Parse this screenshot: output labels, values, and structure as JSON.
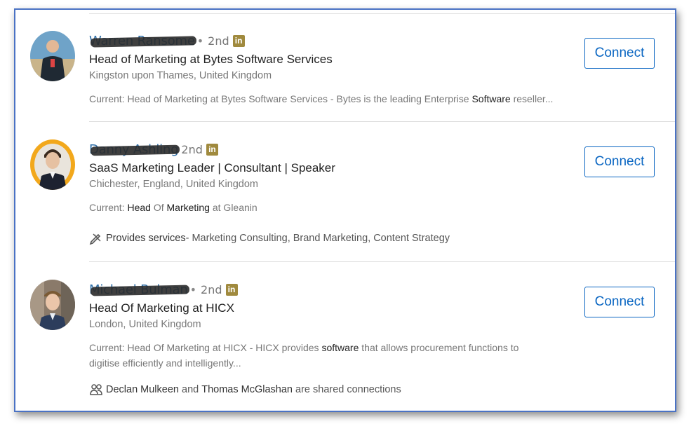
{
  "results": [
    {
      "name": "Warren Ransome",
      "degree": "2nd",
      "li_badge": "in",
      "headline": "Head of Marketing at Bytes Software Services",
      "location": "Kingston upon Thames, United Kingdom",
      "snippet_prefix": "Current: Head of Marketing at Bytes Software Services - Bytes is the leading Enterprise ",
      "snippet_bold": "Software",
      "snippet_suffix": " reseller...",
      "connect_label": "Connect"
    },
    {
      "name": "Danny Ashling",
      "degree": "2nd",
      "li_badge": "in",
      "headline": "SaaS Marketing Leader | Consultant | Speaker",
      "location": "Chichester, England, United Kingdom",
      "snippet_prefix": "Current: ",
      "snippet_b1": "Head",
      "snippet_mid": " Of ",
      "snippet_b2": "Marketing",
      "snippet_suffix": " at Gleanin",
      "services_label": "Provides services",
      "services_text": " - Marketing Consulting, Brand Marketing, Content Strategy",
      "connect_label": "Connect"
    },
    {
      "name": "Michael Bulman",
      "degree": "2nd",
      "li_badge": "in",
      "headline": "Head Of Marketing at HICX",
      "location": "London, United Kingdom",
      "snippet_prefix": "Current: Head Of Marketing at HICX - HICX provides ",
      "snippet_bold": "software",
      "snippet_suffix": " that allows procurement functions to",
      "snippet_line2": "digitise efficiently and intelligently...",
      "shared_a": "Declan Mulkeen",
      "shared_and": " and ",
      "shared_b": "Thomas McGlashan",
      "shared_tail": " are shared connections",
      "connect_label": "Connect"
    }
  ],
  "colors": {
    "link": "#0a66c2",
    "frame_border": "#4a72c4",
    "li_badge": "#a08a3e"
  },
  "icons": {
    "services": "pencil-ruler-icon",
    "shared": "people-icon"
  }
}
